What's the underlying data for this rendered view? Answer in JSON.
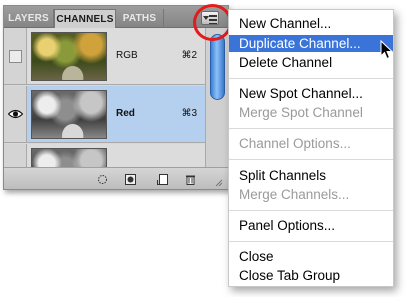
{
  "panel": {
    "tabs": [
      {
        "label": "LAYERS",
        "active": false
      },
      {
        "label": "CHANNELS",
        "active": true
      },
      {
        "label": "PATHS",
        "active": false
      }
    ],
    "menu_button_icon": "panel-menu-icon",
    "channels": [
      {
        "name": "RGB",
        "shortcut": "⌘2",
        "visible": false,
        "selected": false
      },
      {
        "name": "Red",
        "shortcut": "⌘3",
        "visible": true,
        "selected": true
      },
      {
        "name": "",
        "shortcut": "",
        "visible": false,
        "selected": false
      }
    ],
    "footer_icons": [
      "load-selection-icon",
      "save-selection-icon",
      "new-channel-icon",
      "delete-channel-icon"
    ],
    "accent_color": "#e21b1b",
    "selected_row_color": "#b5cfee"
  },
  "menu": {
    "items": [
      {
        "label": "New Channel...",
        "enabled": true,
        "highlighted": false
      },
      {
        "label": "Duplicate Channel...",
        "enabled": true,
        "highlighted": true
      },
      {
        "label": "Delete Channel",
        "enabled": true,
        "highlighted": false
      },
      {
        "label": "New Spot Channel...",
        "enabled": true,
        "highlighted": false
      },
      {
        "label": "Merge Spot Channel",
        "enabled": false,
        "highlighted": false
      },
      {
        "label": "Channel Options...",
        "enabled": false,
        "highlighted": false
      },
      {
        "label": "Split Channels",
        "enabled": true,
        "highlighted": false
      },
      {
        "label": "Merge Channels...",
        "enabled": false,
        "highlighted": false
      },
      {
        "label": "Panel Options...",
        "enabled": true,
        "highlighted": false
      },
      {
        "label": "Close",
        "enabled": true,
        "highlighted": false
      },
      {
        "label": "Close Tab Group",
        "enabled": true,
        "highlighted": false
      }
    ],
    "highlight_color": "#3b74d8"
  }
}
